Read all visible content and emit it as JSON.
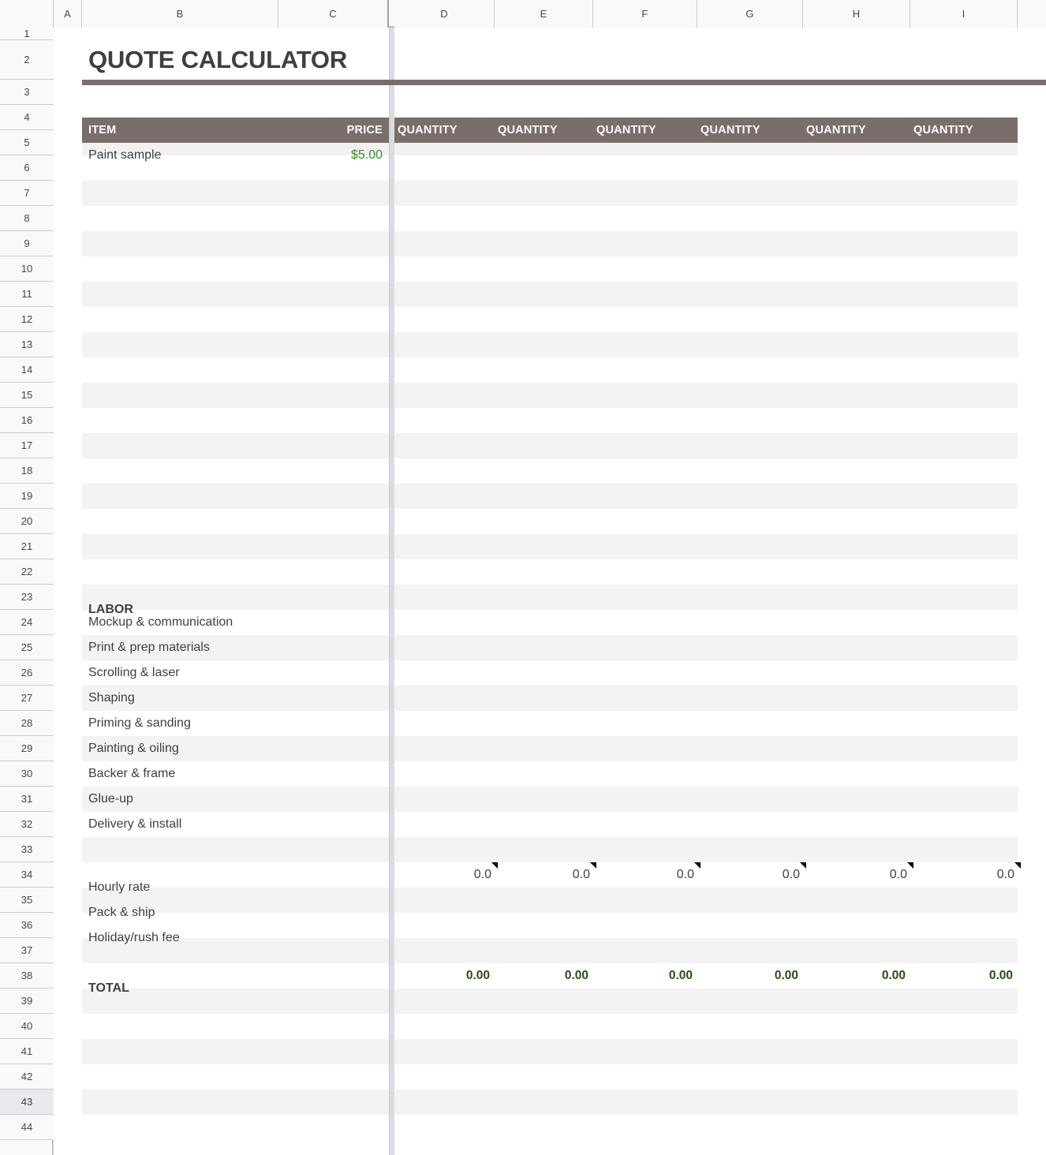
{
  "sheet": {
    "title": "QUOTE CALCULATOR",
    "accent_color": "#7a6e6b",
    "price_color": "#3c8c28",
    "total_color": "#274e13",
    "selected_row": "43"
  },
  "column_headers": [
    "A",
    "B",
    "C",
    "D",
    "E",
    "F",
    "G",
    "H",
    "I"
  ],
  "row_headers": [
    "1",
    "2",
    "3",
    "4",
    "5",
    "6",
    "7",
    "8",
    "9",
    "10",
    "11",
    "12",
    "13",
    "14",
    "15",
    "16",
    "17",
    "18",
    "19",
    "20",
    "21",
    "22",
    "23",
    "24",
    "25",
    "26",
    "27",
    "28",
    "29",
    "30",
    "31",
    "32",
    "33",
    "34",
    "35",
    "36",
    "37",
    "38",
    "39",
    "40",
    "41",
    "42",
    "43",
    "44"
  ],
  "table_header": {
    "item_label": "ITEM",
    "price_label": "PRICE",
    "quantity_labels": [
      "QUANTITY",
      "QUANTITY",
      "QUANTITY",
      "QUANTITY",
      "QUANTITY",
      "QUANTITY"
    ]
  },
  "items": [
    {
      "name": "Paint sample",
      "price": "$5.00"
    }
  ],
  "labor": {
    "section_label": "LABOR",
    "tasks": [
      "Mockup & communication",
      "Print & prep materials",
      "Scrolling & laser",
      "Shaping",
      "Priming & sanding",
      "Painting & oiling",
      "Backer & frame",
      "Glue-up",
      "Delivery & install"
    ]
  },
  "rates": {
    "hourly_rate_label": "Hourly rate",
    "hourly_rate_values": [
      "0.0",
      "0.0",
      "0.0",
      "0.0",
      "0.0",
      "0.0"
    ],
    "pack_ship_label": "Pack & ship",
    "holiday_rush_label": "Holiday/rush fee"
  },
  "total": {
    "label": "TOTAL",
    "values": [
      "0.00",
      "0.00",
      "0.00",
      "0.00",
      "0.00",
      "0.00"
    ]
  }
}
